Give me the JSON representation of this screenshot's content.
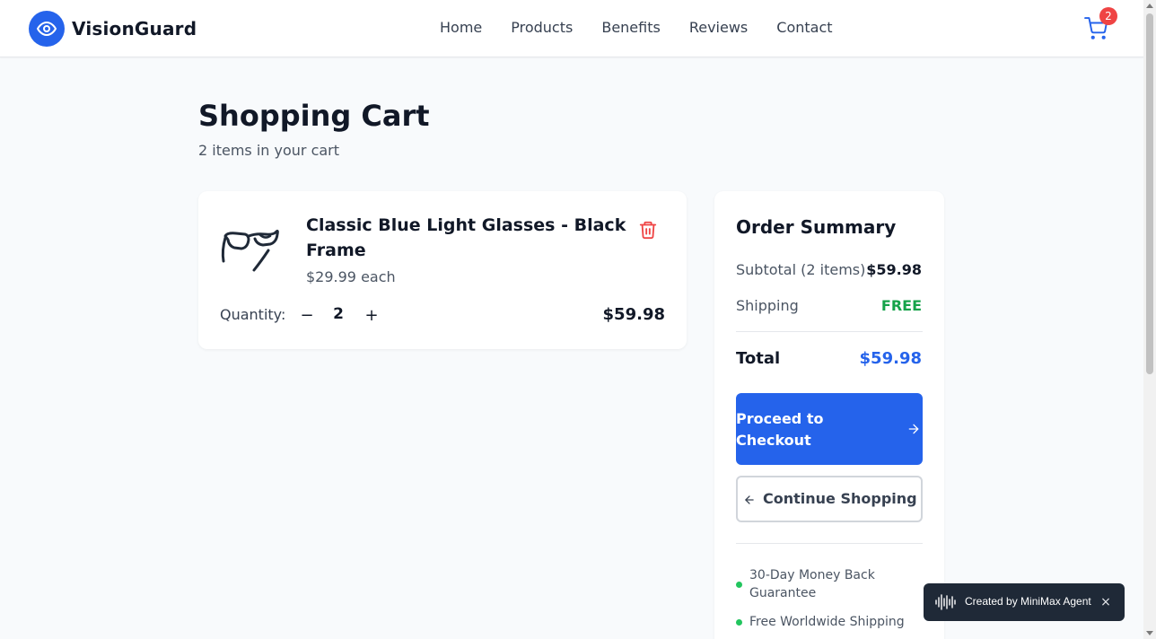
{
  "brand": {
    "name": "VisionGuard",
    "logo_icon": "eye-icon",
    "color": "#2563eb"
  },
  "nav": {
    "items": [
      "Home",
      "Products",
      "Benefits",
      "Reviews",
      "Contact"
    ]
  },
  "cart": {
    "icon": "cart-icon",
    "badge_count": "2"
  },
  "page": {
    "title": "Shopping Cart",
    "subtitle": "2 items in your cart"
  },
  "items": [
    {
      "name": "Classic Blue Light Glasses - Black Frame",
      "unit_price": "$29.99 each",
      "quantity_label": "Quantity:",
      "quantity": "2",
      "minus": "−",
      "plus": "+",
      "line_total": "$59.98",
      "image_icon": "glasses-image",
      "delete_icon": "trash-icon"
    }
  ],
  "summary": {
    "title": "Order Summary",
    "subtotal_label": "Subtotal (2 items)",
    "subtotal_value": "$59.98",
    "shipping_label": "Shipping",
    "shipping_value": "FREE",
    "total_label": "Total",
    "total_value": "$59.98",
    "checkout_label": "Proceed to Checkout",
    "continue_label": "Continue Shopping",
    "features": [
      "30-Day Money Back Guarantee",
      "Free Worldwide Shipping"
    ]
  },
  "toast": {
    "text": "Created by MiniMax Agent",
    "close": "×"
  },
  "colors": {
    "accent": "#2563eb",
    "success": "#16a34a",
    "danger": "#ef4444",
    "badge": "#ef4444"
  }
}
